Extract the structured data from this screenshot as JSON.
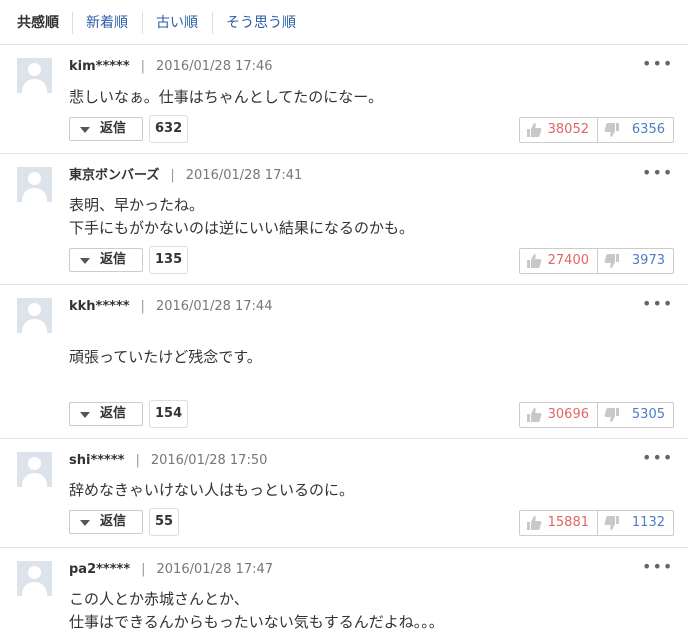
{
  "tabs": [
    "共感順",
    "新着順",
    "古い順",
    "そう思う順"
  ],
  "reply_label": "返信",
  "comments": [
    {
      "user": "kim*****",
      "date": "2016/01/28 17:46",
      "lines": [
        "悲しいなぁ。仕事はちゃんとしてたのになー。"
      ],
      "replies": "632",
      "likes": "38052",
      "dislikes": "6356"
    },
    {
      "user": "東京ボンバーズ",
      "date": "2016/01/28 17:41",
      "lines": [
        "表明、早かったね。",
        "下手にもがかないのは逆にいい結果になるのかも。"
      ],
      "replies": "135",
      "likes": "27400",
      "dislikes": "3973"
    },
    {
      "user": "kkh*****",
      "date": "2016/01/28 17:44",
      "lines": [
        "頑張っていたけど残念です。"
      ],
      "replies": "154",
      "likes": "30696",
      "dislikes": "5305"
    },
    {
      "user": "shi*****",
      "date": "2016/01/28 17:50",
      "lines": [
        "辞めなきゃいけない人はもっといるのに。"
      ],
      "replies": "55",
      "likes": "15881",
      "dislikes": "1132"
    },
    {
      "user": "pa2*****",
      "date": "2016/01/28 17:47",
      "lines": [
        "この人とか赤城さんとか、",
        "仕事はできるんからもったいない気もするんだよね。。。"
      ]
    }
  ]
}
